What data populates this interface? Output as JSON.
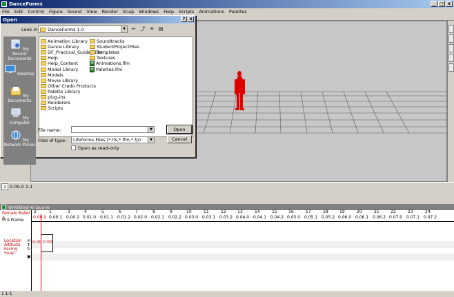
{
  "app": {
    "title": "DanceForms",
    "window_buttons": [
      "_",
      "□",
      "x"
    ]
  },
  "menu": [
    "File",
    "Edit",
    "Control",
    "Figure",
    "Sound",
    "View",
    "Render",
    "Snap",
    "Windows",
    "Help",
    "Scripts",
    "Animations",
    "Palettes"
  ],
  "dialog": {
    "title": "Open",
    "title_buttons": [
      "?",
      "x"
    ],
    "look_in_label": "Look in:",
    "look_in_value": "DanceForms 1.0",
    "places": [
      "My Recent Documents",
      "Desktop",
      "My Documents",
      "My Computer",
      "My Network Places"
    ],
    "files_col1": [
      {
        "name": "Animation Library",
        "type": "folder"
      },
      {
        "name": "Dance Library",
        "type": "folder"
      },
      {
        "name": "DF_Practical_Guide_Files",
        "type": "folder"
      },
      {
        "name": "Help",
        "type": "folder"
      },
      {
        "name": "Help_Content",
        "type": "folder"
      },
      {
        "name": "Model Library",
        "type": "folder"
      },
      {
        "name": "Models",
        "type": "folder"
      },
      {
        "name": "Movie Library",
        "type": "folder"
      },
      {
        "name": "Other Credo Products",
        "type": "folder"
      },
      {
        "name": "Palette Library",
        "type": "folder"
      },
      {
        "name": "plug-ins",
        "type": "folder"
      },
      {
        "name": "Renderers",
        "type": "folder"
      },
      {
        "name": "Scripts",
        "type": "folder"
      }
    ],
    "files_col2": [
      {
        "name": "Soundtracks",
        "type": "folder"
      },
      {
        "name": "StudentProjectFiles",
        "type": "folder"
      },
      {
        "name": "Templates",
        "type": "folder"
      },
      {
        "name": "Textures",
        "type": "folder"
      },
      {
        "name": "Animations.lfm",
        "type": "file"
      },
      {
        "name": "Palettes.lfm",
        "type": "file"
      }
    ],
    "file_name_label": "File name:",
    "file_name_value": "",
    "files_of_type_label": "Files of type:",
    "files_of_type_value": "Lifeforms Files (*.lfs,*.lfm,*.fp)",
    "read_only_label": "Open as read-only",
    "open_button": "Open",
    "cancel_button": "Cancel"
  },
  "status": {
    "frame": "1",
    "text": "0.00.0  1-1"
  },
  "score": {
    "title": "Untitled-0:Score",
    "performer": "Female Ballet A",
    "ms_frame": "M S Frame",
    "properties": [
      "Location",
      "Altitude",
      "Facing",
      "Snap"
    ],
    "playhead_label": "0.00.0",
    "key_value": "0.00.0 00",
    "ruler_marks": [
      "2",
      "1",
      "3",
      "4",
      "5",
      "6",
      "7",
      "8",
      "9",
      "10",
      "11",
      "12",
      "13",
      "14",
      "15",
      "16",
      "17",
      "18",
      "19",
      "20",
      "21",
      "22",
      "23",
      "24"
    ],
    "ruler_times": [
      "0.00.1",
      "0.00.2",
      "0.01.0",
      "0.01.1",
      "0.01.2",
      "0.02.0",
      "0.02.1",
      "0.02.2",
      "0.03.0",
      "0.03.1",
      "0.03.2",
      "0.04.0",
      "0.04.1",
      "0.04.2",
      "0.05.0",
      "0.05.1",
      "0.05.2",
      "0.06.0",
      "0.06.1",
      "0.06.2",
      "0.07.0",
      "0.07.1",
      "0.07.2"
    ],
    "status_text": "1  1-1"
  },
  "colors": {
    "figure": "#e00000",
    "title_active": "#0a246a",
    "floor_grid": "#5a5a5a"
  }
}
